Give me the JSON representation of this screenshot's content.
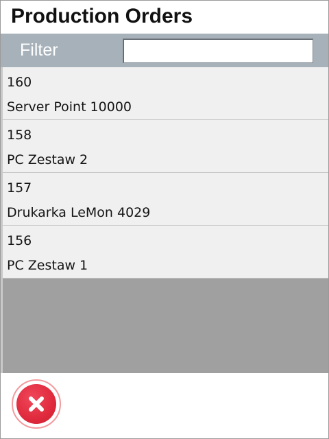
{
  "header": {
    "title": "Production Orders"
  },
  "filter": {
    "label": "Filter",
    "value": "",
    "placeholder": ""
  },
  "orders": [
    {
      "number": "160",
      "name": "Server Point 10000"
    },
    {
      "number": "158",
      "name": "PC Zestaw 2"
    },
    {
      "number": "157",
      "name": "Drukarka LeMon 4029"
    },
    {
      "number": "156",
      "name": "PC Zestaw 1"
    }
  ],
  "footer": {
    "close_icon": "close-icon",
    "accent_color": "#e02a3d"
  }
}
